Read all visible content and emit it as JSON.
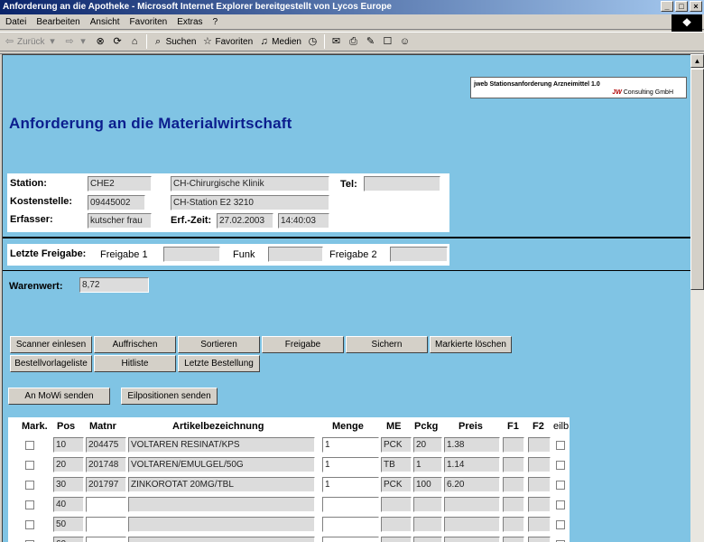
{
  "window": {
    "title": "Anforderung an die Apotheke - Microsoft Internet Explorer bereitgestellt von Lycos Europe",
    "controls": [
      "_",
      "□",
      "×"
    ]
  },
  "menu": [
    "Datei",
    "Bearbeiten",
    "Ansicht",
    "Favoriten",
    "Extras",
    "?"
  ],
  "toolbar": {
    "back": "Zurück",
    "search": "Suchen",
    "favorites": "Favoriten",
    "media": "Medien"
  },
  "brand": {
    "line1": "jweb Stationsanforderung Arzneimittel 1.0",
    "logo": "JW",
    "line2": "Consulting GmbH"
  },
  "page_title": "Anforderung an die Materialwirtschaft",
  "header": {
    "station_label": "Station:",
    "station_code": "CHE2",
    "station_name": "CH-Chirurgische Klinik",
    "tel_label": "Tel:",
    "tel_value": "",
    "kst_label": "Kostenstelle:",
    "kst_code": "09445002",
    "kst_name": "CH-Station E2         3210",
    "erf_label": "Erfasser:",
    "erf_value": "kutscher frau",
    "erfzeit_label": "Erf.-Zeit:",
    "erfzeit_date": "27.02.2003",
    "erfzeit_time": "14:40:03"
  },
  "release": {
    "label": "Letzte Freigabe:",
    "f1_label": "Freigabe 1",
    "f1_value": "",
    "funk_label": "Funk",
    "funk_value": "",
    "f2_label": "Freigabe 2",
    "f2_value": ""
  },
  "warenwert": {
    "label": "Warenwert:",
    "value": "8,72"
  },
  "buttons": {
    "row1": [
      "Scanner einlesen",
      "Auffrischen",
      "Sortieren",
      "Freigabe",
      "Sichern",
      "Markierte löschen"
    ],
    "row2": [
      "Bestellvorlageliste",
      "Hitliste",
      "Letzte Bestellung"
    ],
    "row3": [
      "An MoWi senden",
      "Eilpositionen senden"
    ]
  },
  "grid": {
    "headers": [
      "Mark.",
      "Pos",
      "Matnr",
      "Artikelbezeichnung",
      "Menge",
      "ME",
      "Pckg",
      "Preis",
      "F1",
      "F2",
      "eilb"
    ],
    "rows": [
      {
        "pos": "10",
        "matnr": "204475",
        "desc": "VOLTAREN RESINAT/KPS",
        "menge": "1",
        "me": "PCK",
        "pckg": "20",
        "preis": "1.38"
      },
      {
        "pos": "20",
        "matnr": "201748",
        "desc": "VOLTAREN/EMULGEL/50G",
        "menge": "1",
        "me": "TB",
        "pckg": "1",
        "preis": "1.14"
      },
      {
        "pos": "30",
        "matnr": "201797",
        "desc": "ZINKOROTAT 20MG/TBL",
        "menge": "1",
        "me": "PCK",
        "pckg": "100",
        "preis": "6.20"
      },
      {
        "pos": "40",
        "matnr": "",
        "desc": "",
        "menge": "",
        "me": "",
        "pckg": "",
        "preis": ""
      },
      {
        "pos": "50",
        "matnr": "",
        "desc": "",
        "menge": "",
        "me": "",
        "pckg": "",
        "preis": ""
      },
      {
        "pos": "60",
        "matnr": "",
        "desc": "",
        "menge": "",
        "me": "",
        "pckg": "",
        "preis": ""
      }
    ]
  }
}
